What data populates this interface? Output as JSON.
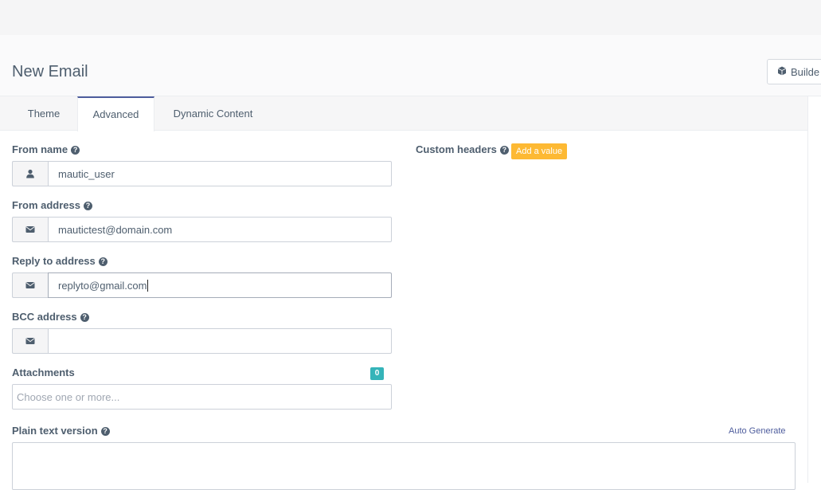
{
  "header": {
    "title": "New Email",
    "builder_label": "Builde"
  },
  "tabs": [
    {
      "label": "Theme",
      "active": false
    },
    {
      "label": "Advanced",
      "active": true
    },
    {
      "label": "Dynamic Content",
      "active": false
    }
  ],
  "form": {
    "from_name": {
      "label": "From name",
      "value": "mautic_user",
      "icon": "user-icon"
    },
    "from_address": {
      "label": "From address",
      "value": "mautictest@domain.com",
      "icon": "envelope-icon"
    },
    "reply_to": {
      "label": "Reply to address",
      "value": "replyto@gmail.com",
      "icon": "envelope-icon"
    },
    "bcc": {
      "label": "BCC address",
      "value": "",
      "icon": "envelope-icon"
    },
    "attachments": {
      "label": "Attachments",
      "count": "0",
      "placeholder": "Choose one or more..."
    },
    "plain_text": {
      "label": "Plain text version",
      "auto_generate": "Auto Generate",
      "value": ""
    },
    "custom_headers": {
      "label": "Custom headers",
      "add_label": "Add a value"
    }
  },
  "colors": {
    "accent": "#4e5d9d",
    "orange_badge": "#fdb933",
    "teal_badge": "#35b4b9",
    "text": "#4e5e6e"
  }
}
